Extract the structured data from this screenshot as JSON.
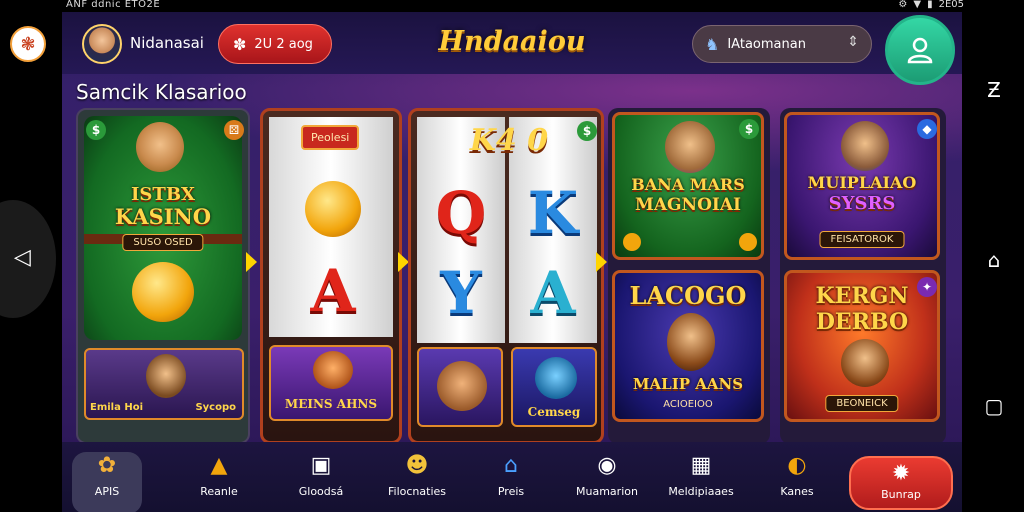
{
  "status_bar": {
    "left_text": "ANF ddnic ETO2E",
    "right_text": "2E05"
  },
  "header": {
    "username": "Nidanasai",
    "balance": "2U 2 aog",
    "logo": "Hndaaiou",
    "selector_value": "IAtaomanan",
    "profile_icon": "person-icon"
  },
  "section": {
    "title": "Samcik Klasarioo"
  },
  "cards": {
    "casino": {
      "title_line1": "ISTBX",
      "title_line2": "KASINO",
      "sub": "SUSO OSED",
      "bottom": "Emila Hoi",
      "bottom_right": "Sycopo"
    },
    "slot1": {
      "tag": "Peolesi",
      "bottom": "MEINS AHNS"
    },
    "slot2": {
      "top": "K4 0",
      "bottom": "Cemseg"
    },
    "bana": {
      "title_line1": "BANA MARS",
      "title_line2": "MAGNOIAI"
    },
    "muiplaiao": {
      "title_line1": "MUIPLAIAO",
      "title_line2": "SYSRS",
      "sub": "FEISATOROK"
    },
    "lacogo": {
      "title": "LACOGO",
      "sub": "MALIP AANS",
      "sub2": "ACIOEIOO"
    },
    "kergn": {
      "title_line1": "KERGN",
      "title_line2": "DERBO",
      "sub": "BEONEICK"
    }
  },
  "bottom_nav": [
    {
      "label": "APIS",
      "icon": "gear-icon"
    },
    {
      "label": "Reanle",
      "icon": "bell-icon"
    },
    {
      "label": "Gloodsá",
      "icon": "chart-icon"
    },
    {
      "label": "Filocnaties",
      "icon": "smile-icon"
    },
    {
      "label": "Preis",
      "icon": "gift-icon"
    },
    {
      "label": "Muamarion",
      "icon": "camera-icon"
    },
    {
      "label": "Meldipiaaes",
      "icon": "grid-icon"
    },
    {
      "label": "Kanes",
      "icon": "chat-icon"
    },
    {
      "label": "Bunrap",
      "icon": "settings-icon"
    }
  ],
  "colors": {
    "accent_red": "#d9272a",
    "accent_green": "#27c08f",
    "gold": "#ffcc3a",
    "bg_purple": "#35206a"
  }
}
